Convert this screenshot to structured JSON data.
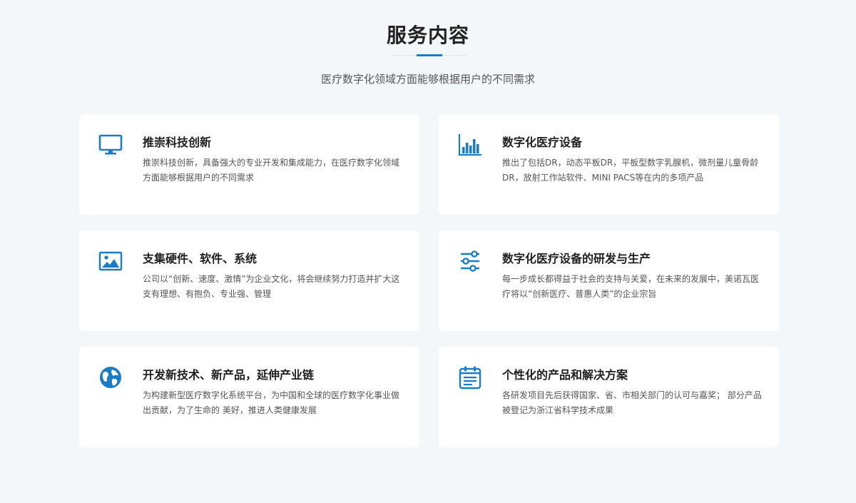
{
  "header": {
    "title": "服务内容",
    "subtitle": "医疗数字化领域方面能够根据用户的不同需求"
  },
  "colors": {
    "accent": "#1a7cc8",
    "background": "#f4f7fa",
    "card": "#ffffff"
  },
  "cards": [
    {
      "icon": "monitor-icon",
      "title": "推崇科技创新",
      "desc": "推崇科技创新，具备强大的专业开发和集成能力，在医疗数字化领域方面能够根据用户的不同需求"
    },
    {
      "icon": "bar-chart-icon",
      "title": "数字化医疗设备",
      "desc": "推出了包括DR，动态平板DR，平板型数字乳腺机，微剂量儿童骨龄DR，放射工作站软件、MINI PACS等在内的多项产品"
    },
    {
      "icon": "image-icon",
      "title": "支集硬件、软件、系统",
      "desc": "公司以“创新、速度、激情”为企业文化，将会继续努力打造并扩大这支有理想、有抱负、专业强、管理"
    },
    {
      "icon": "sliders-icon",
      "title": "数字化医疗设备的研发与生产",
      "desc": "每一步成长都得益于社会的支持与关爱，在未来的发展中，美诺瓦医疗将以“创新医疗、普惠人类”的企业宗旨"
    },
    {
      "icon": "globe-icon",
      "title": "开发新技术、新产品，延伸产业链",
      "desc": "为构建新型医疗数字化系统平台，为中国和全球的医疗数字化事业做出贡献，为了生命的 美好，推进人类健康发展"
    },
    {
      "icon": "calendar-icon",
      "title": "个性化的产品和解决方案",
      "desc": "各研发项目先后获得国家、省、市相关部门的认可与嘉奖； 部分产品被登记为浙江省科学技术成果"
    }
  ]
}
